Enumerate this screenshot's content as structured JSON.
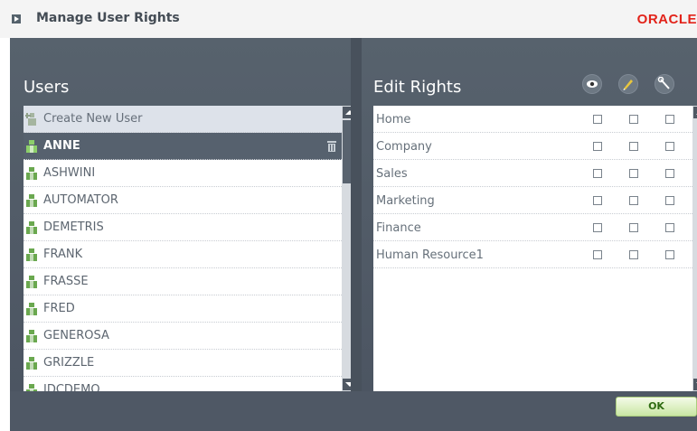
{
  "window": {
    "title": "Manage User Rights",
    "brand": "ORACLE",
    "brand_color": "#e2231a"
  },
  "users_panel": {
    "header": "Users",
    "create_label": "Create New User",
    "items": [
      {
        "name": "ANNE",
        "selected": true
      },
      {
        "name": "ASHWINI"
      },
      {
        "name": "AUTOMATOR"
      },
      {
        "name": "DEMETRIS"
      },
      {
        "name": "FRANK"
      },
      {
        "name": "FRASSE"
      },
      {
        "name": "FRED"
      },
      {
        "name": "GENEROSA"
      },
      {
        "name": "GRIZZLE"
      },
      {
        "name": "IDCDEMO"
      }
    ]
  },
  "rights_panel": {
    "header": "Edit Rights",
    "columns": [
      "view-icon",
      "edit-icon",
      "admin-wrench-icon"
    ],
    "rows": [
      {
        "label": "Home"
      },
      {
        "label": "Company"
      },
      {
        "label": "Sales"
      },
      {
        "label": "Marketing"
      },
      {
        "label": "Finance"
      },
      {
        "label": "Human Resource1"
      }
    ]
  },
  "footer": {
    "ok_label": "OK"
  },
  "colors": {
    "dialog_bg": "#4b5562",
    "selected_row": "#56616e",
    "ok_text": "#2f6b12"
  }
}
